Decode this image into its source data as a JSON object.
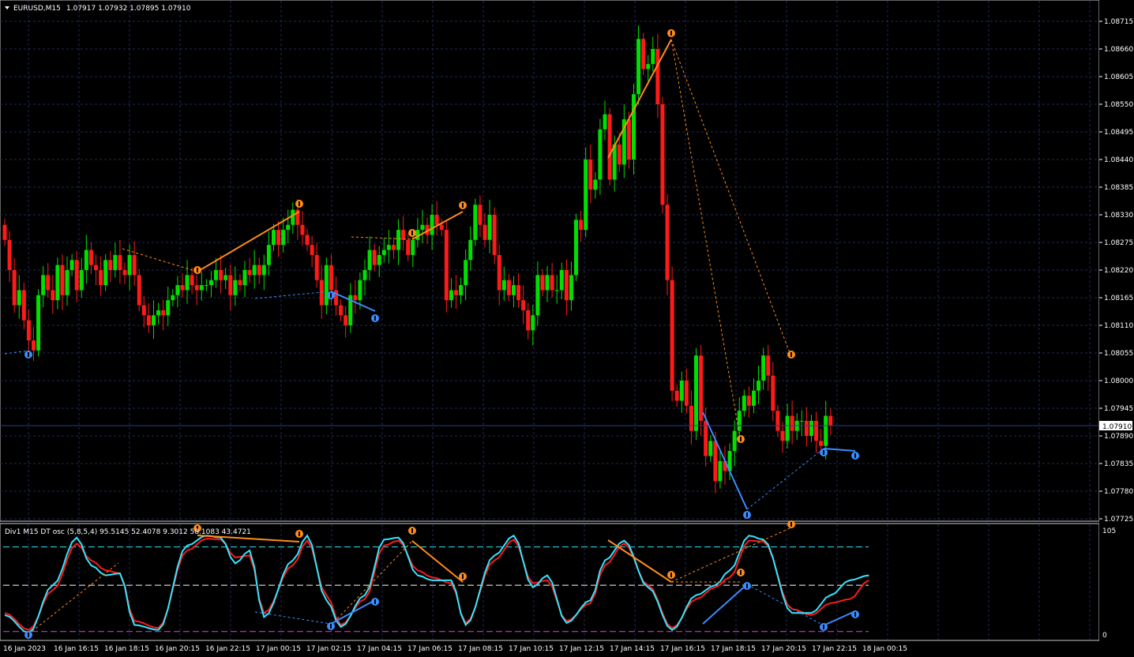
{
  "main_header": {
    "symbol": "EURUSD,M15",
    "ohlc": "1.07917 1.07932 1.07895 1.07910"
  },
  "indicator_header": "Div1 M15 DT osc (5,8,5,4) 95.5145 52.4078 9.3012 58.1083 43.4721",
  "current_price_label": "1.07910",
  "colors": {
    "background": "#000000",
    "grid": "#1e2a5a",
    "bull": "#00e000",
    "bear": "#ff1a1a",
    "osc_fast": "#33e6ff",
    "osc_slow": "#ff1a1a",
    "divergence_bear": "#ff8c1a",
    "divergence_bull": "#3a8cff",
    "level_upper": "#33e6ff",
    "level_lower": "#e040e0",
    "level_mid": "#ffffff",
    "axis_text": "#ffffff",
    "price_line": "#2a3a9a"
  },
  "icons": {
    "bear_arrow": "down-arrow-marker-icon",
    "bull_arrow": "up-arrow-marker-icon",
    "header_menu": "triangle-down-icon"
  },
  "chart_data": [
    {
      "type": "candlestick",
      "title": "EURUSD,M15",
      "ylim": [
        1.07725,
        1.08715
      ],
      "yticks": [
        "1.08715",
        "1.08660",
        "1.08605",
        "1.08550",
        "1.08495",
        "1.08440",
        "1.08385",
        "1.08330",
        "1.08275",
        "1.08220",
        "1.08165",
        "1.08110",
        "1.08055",
        "1.08000",
        "1.07945",
        "1.07890",
        "1.07835",
        "1.07780",
        "1.07725"
      ],
      "current_price": 1.0791,
      "closes": [
        1.0828,
        1.0822,
        1.0815,
        1.0818,
        1.0812,
        1.0808,
        1.0806,
        1.0817,
        1.0821,
        1.0818,
        1.0816,
        1.0823,
        1.0817,
        1.0822,
        1.0824,
        1.0818,
        1.0822,
        1.0826,
        1.0823,
        1.0822,
        1.0819,
        1.0824,
        1.0822,
        1.0825,
        1.0822,
        1.0821,
        1.0825,
        1.0821,
        1.0815,
        1.0813,
        1.0811,
        1.0813,
        1.0814,
        1.0813,
        1.0816,
        1.0817,
        1.0819,
        1.0818,
        1.0821,
        1.0819,
        1.0818,
        1.0819,
        1.0819,
        1.082,
        1.0822,
        1.082,
        1.0821,
        1.0817,
        1.082,
        1.0819,
        1.0822,
        1.0821,
        1.0823,
        1.0821,
        1.0823,
        1.0827,
        1.083,
        1.0827,
        1.083,
        1.0831,
        1.0834,
        1.0831,
        1.0829,
        1.0827,
        1.0825,
        1.082,
        1.0815,
        1.0823,
        1.0818,
        1.0815,
        1.0813,
        1.0811,
        1.0817,
        1.0816,
        1.082,
        1.0822,
        1.0826,
        1.0823,
        1.0825,
        1.0826,
        1.0827,
        1.0826,
        1.083,
        1.0828,
        1.0825,
        1.0828,
        1.083,
        1.0831,
        1.0829,
        1.0833,
        1.0831,
        1.083,
        1.0816,
        1.0818,
        1.0817,
        1.0819,
        1.0824,
        1.0828,
        1.0835,
        1.0831,
        1.0828,
        1.0833,
        1.0825,
        1.0818,
        1.082,
        1.0817,
        1.0819,
        1.0816,
        1.0814,
        1.081,
        1.0813,
        1.0821,
        1.0818,
        1.0821,
        1.0818,
        1.0818,
        1.0822,
        1.0816,
        1.0821,
        1.0832,
        1.083,
        1.0844,
        1.0838,
        1.084,
        1.085,
        1.0853,
        1.084,
        1.0847,
        1.0843,
        1.0852,
        1.0844,
        1.0857,
        1.0868,
        1.0862,
        1.0863,
        1.0866,
        1.0855,
        1.0835,
        1.082,
        1.0798,
        1.0796,
        1.08,
        1.0795,
        1.079,
        1.0805,
        1.0792,
        1.0785,
        1.0788,
        1.078,
        1.0784,
        1.0782,
        1.0786,
        1.079,
        1.0794,
        1.0797,
        1.0795,
        1.0798,
        1.08,
        1.0805,
        1.0801,
        1.0794,
        1.079,
        1.0788,
        1.0793,
        1.079,
        1.0792,
        1.0792,
        1.0789,
        1.0792,
        1.0788,
        1.0787,
        1.0793,
        1.0791
      ]
    },
    {
      "type": "line",
      "title": "Div1 M15 DT osc (5,8,5,4)",
      "ylim": [
        0,
        105
      ],
      "yticks": [
        "105",
        "0"
      ],
      "levels": {
        "upper": 95,
        "mid": 50,
        "lower": 5
      },
      "x": [
        "16 Jan 2023",
        "16 Jan 16:15",
        "16 Jan 18:15",
        "16 Jan 20:15",
        "16 Jan 22:15",
        "17 Jan 00:15",
        "17 Jan 02:15",
        "17 Jan 04:15",
        "17 Jan 06:15",
        "17 Jan 08:15",
        "17 Jan 10:15",
        "17 Jan 12:15",
        "17 Jan 14:15",
        "17 Jan 16:15",
        "17 Jan 18:15",
        "17 Jan 20:15",
        "17 Jan 22:15",
        "18 Jan 00:15"
      ],
      "series": [
        {
          "fast_anchors": [
            [
              0,
              20
            ],
            [
              5,
              2
            ],
            [
              10,
              50
            ],
            [
              15,
              98
            ],
            [
              18,
              70
            ],
            [
              21,
              60
            ],
            [
              24,
              62
            ],
            [
              27,
              10
            ],
            [
              32,
              5
            ],
            [
              38,
              90
            ],
            [
              42,
              100
            ],
            [
              45,
              98
            ],
            [
              48,
              72
            ],
            [
              51,
              85
            ],
            [
              54,
              18
            ],
            [
              60,
              75
            ],
            [
              63,
              100
            ],
            [
              67,
              35
            ],
            [
              70,
              8
            ],
            [
              75,
              40
            ],
            [
              79,
              96
            ],
            [
              82,
              98
            ],
            [
              86,
              60
            ],
            [
              89,
              55
            ],
            [
              93,
              55
            ],
            [
              96,
              10
            ],
            [
              102,
              80
            ],
            [
              106,
              100
            ],
            [
              110,
              48
            ],
            [
              113,
              60
            ],
            [
              117,
              12
            ],
            [
              122,
              35
            ],
            [
              125,
              75
            ],
            [
              129,
              95
            ],
            [
              134,
              48
            ],
            [
              139,
              5
            ],
            [
              144,
              40
            ],
            [
              148,
              50
            ],
            [
              151,
              65
            ],
            [
              155,
              100
            ],
            [
              158,
              96
            ],
            [
              164,
              22
            ],
            [
              168,
              22
            ],
            [
              172,
              40
            ],
            [
              176,
              55
            ],
            [
              180,
              60
            ]
          ]
        },
        {
          "slow_anchors": [
            [
              0,
              22
            ],
            [
              5,
              5
            ],
            [
              10,
              45
            ],
            [
              15,
              92
            ],
            [
              18,
              75
            ],
            [
              21,
              65
            ],
            [
              24,
              62
            ],
            [
              27,
              14
            ],
            [
              32,
              7
            ],
            [
              38,
              85
            ],
            [
              42,
              97
            ],
            [
              45,
              96
            ],
            [
              48,
              78
            ],
            [
              51,
              80
            ],
            [
              54,
              22
            ],
            [
              60,
              70
            ],
            [
              63,
              95
            ],
            [
              67,
              40
            ],
            [
              70,
              10
            ],
            [
              75,
              36
            ],
            [
              79,
              90
            ],
            [
              82,
              95
            ],
            [
              86,
              65
            ],
            [
              89,
              58
            ],
            [
              93,
              52
            ],
            [
              96,
              12
            ],
            [
              102,
              75
            ],
            [
              106,
              96
            ],
            [
              110,
              52
            ],
            [
              113,
              55
            ],
            [
              117,
              14
            ],
            [
              122,
              32
            ],
            [
              125,
              70
            ],
            [
              129,
              92
            ],
            [
              134,
              50
            ],
            [
              139,
              7
            ],
            [
              144,
              36
            ],
            [
              148,
              48
            ],
            [
              151,
              58
            ],
            [
              155,
              95
            ],
            [
              158,
              94
            ],
            [
              164,
              26
            ],
            [
              168,
              20
            ],
            [
              172,
              32
            ],
            [
              176,
              36
            ],
            [
              180,
              55
            ]
          ]
        }
      ]
    }
  ]
}
